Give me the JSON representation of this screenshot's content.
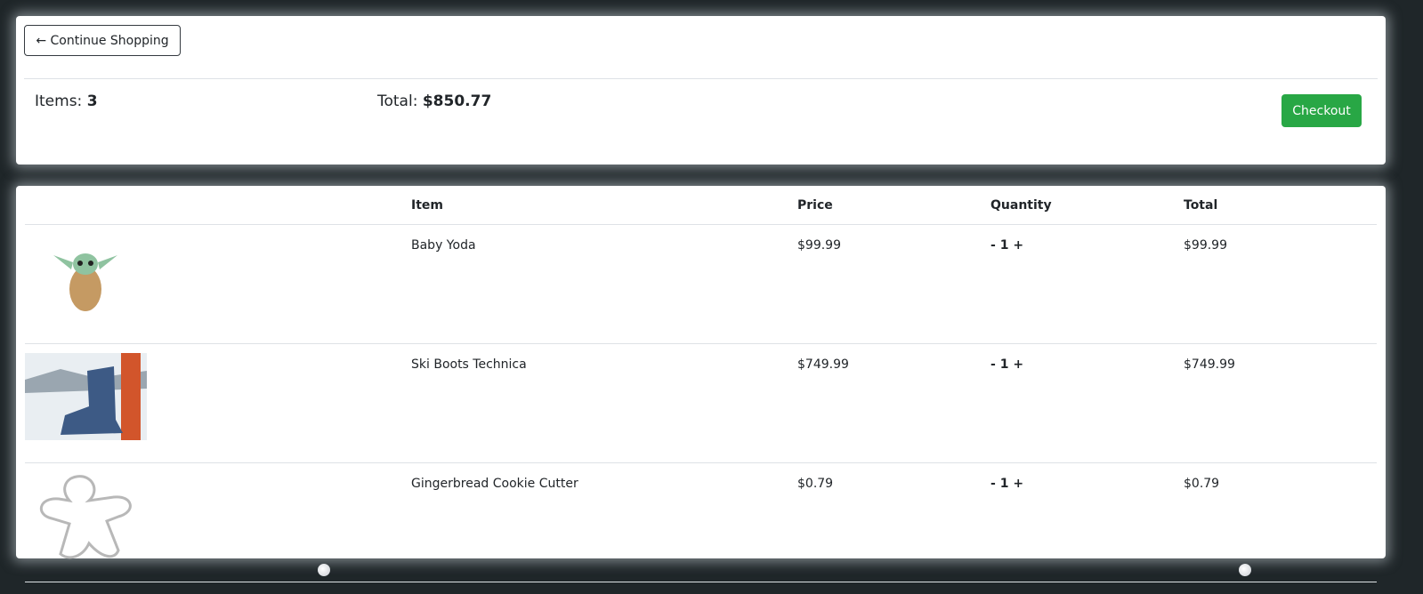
{
  "summary": {
    "back_label": "← Continue Shopping",
    "items_label": "Items:",
    "items_count": "3",
    "total_label": "Total:",
    "total_value": "$850.77",
    "checkout_label": "Checkout"
  },
  "colors": {
    "checkout": "#28a745",
    "background": "#1f2629"
  },
  "table": {
    "headers": [
      "",
      "Item",
      "Price",
      "Quantity",
      "Total"
    ],
    "rows": [
      {
        "name": "Baby Yoda",
        "price": "$99.99",
        "minus": "-",
        "qty": "1",
        "plus": "+",
        "total": "$99.99"
      },
      {
        "name": "Ski Boots Technica",
        "price": "$749.99",
        "minus": "-",
        "qty": "1",
        "plus": "+",
        "total": "$749.99"
      },
      {
        "name": "Gingerbread Cookie Cutter",
        "price": "$0.79",
        "minus": "-",
        "qty": "1",
        "plus": "+",
        "total": "$0.79"
      }
    ]
  }
}
